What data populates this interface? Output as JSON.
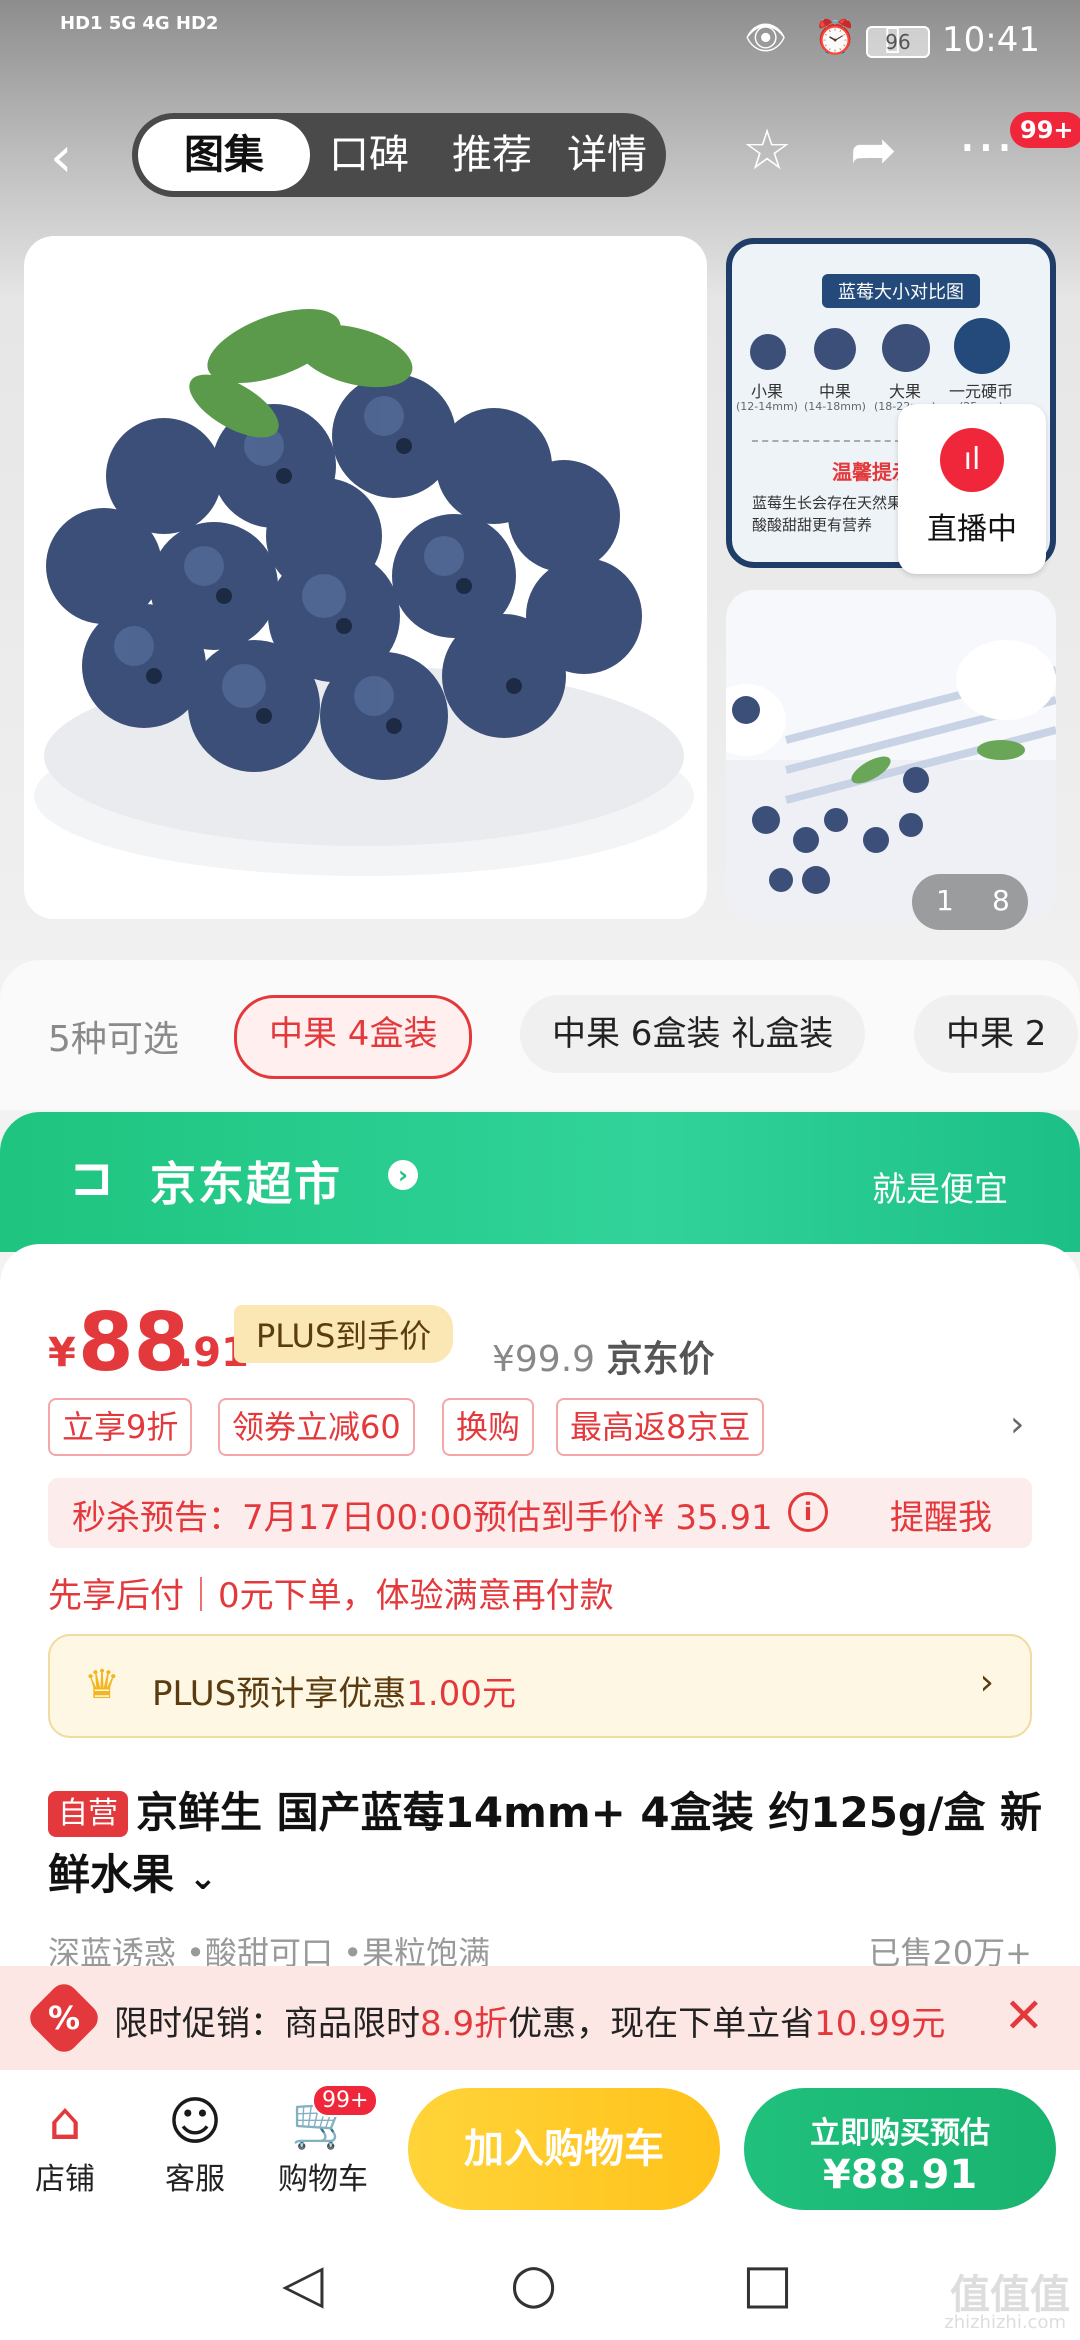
{
  "status_bar": {
    "network": "HD1 5G 4G HD2",
    "battery": "96",
    "time": "10:41"
  },
  "nav": {
    "tabs": [
      "图集",
      "口碑",
      "推荐",
      "详情"
    ],
    "more_badge": "99+"
  },
  "gallery": {
    "compare_title": "蓝莓大小对比图",
    "compare_items": [
      {
        "label": "小果",
        "size": "(12-14mm)"
      },
      {
        "label": "中果",
        "size": "(14-18mm)"
      },
      {
        "label": "大果",
        "size": "(18-22mm)"
      },
      {
        "label": "一元硬币",
        "size": "(25mm)"
      }
    ],
    "compare_note_title": "温馨提示",
    "compare_note": "蓝莓生长会存在天然果粉 酸酸甜甜更有营养",
    "live_label": "直播中",
    "counter_current": "1",
    "counter_total": "8"
  },
  "variants": {
    "count_label": "5种可选",
    "options": [
      "中果 4盒装",
      "中果 6盒装 礼盒装",
      "中果 2"
    ]
  },
  "jd_banner": {
    "title": "京东超市",
    "slogan": "就是便宜"
  },
  "price": {
    "symbol": "¥",
    "integer": "88",
    "decimal": ".91",
    "plus_tag": "PLUS到手价",
    "jd_price": "¥99.9",
    "jd_price_label": "京东价"
  },
  "promos": [
    "立享9折",
    "领券立减60",
    "换购",
    "最高返8京豆"
  ],
  "seckill": {
    "text": "秒杀预告：7月17日00:00预估到手价¥ 35.91",
    "info_icon": "i",
    "remind": "提醒我"
  },
  "paylater": "先享后付｜0元下单，体验满意再付款",
  "plus_bar": {
    "text": "PLUS预计享优惠",
    "amount": "1.00元"
  },
  "product": {
    "tag": "自营",
    "title": "京鲜生 国产蓝莓14mm+ 4盒装 约125g/盒 新鲜水果",
    "features": "深蓝诱惑 •酸甜可口 •果粒饱满",
    "sold": "已售20万+"
  },
  "promo_strip": {
    "icon": "%",
    "text_a": "限时促销：商品限时",
    "rate": "8.9折",
    "text_b": "优惠，现在下单立省",
    "save": "10.99元"
  },
  "action_bar": {
    "shop": "店铺",
    "service": "客服",
    "cart": "购物车",
    "cart_badge": "99+",
    "add_to_cart": "加入购物车",
    "buy_now": "立即购买预估",
    "buy_price": "¥88.91"
  },
  "watermark": {
    "main": "值值值",
    "sub": "zhizhizhi.com"
  }
}
